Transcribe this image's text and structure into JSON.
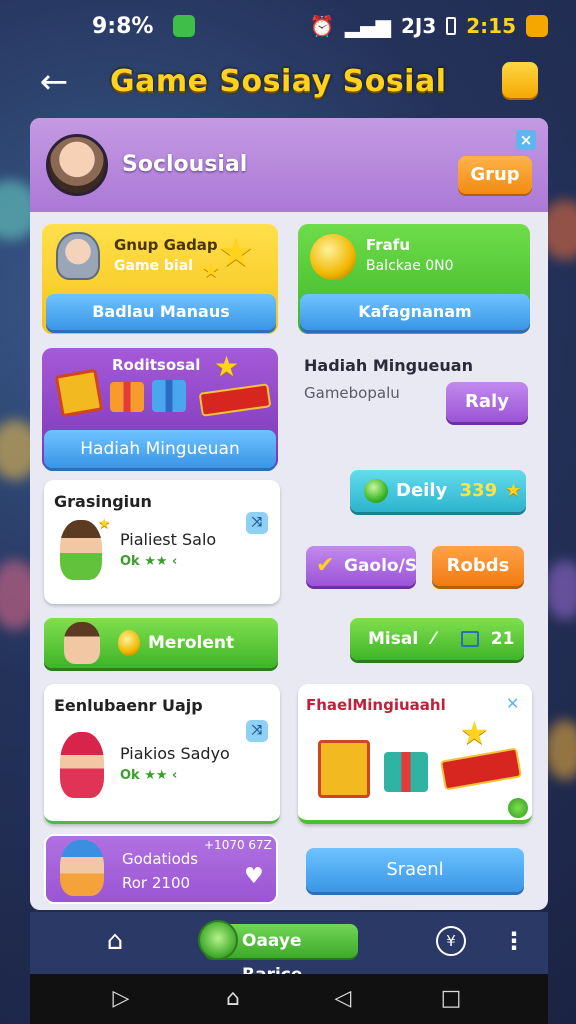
{
  "status_bar": {
    "battery_percent": "9:8%",
    "carrier": "2J3",
    "time": "2:15"
  },
  "header": {
    "title": "Game Sosiay  Sosial"
  },
  "profile": {
    "name": "Soclousial",
    "grup_label": "Grup",
    "close_symbol": "×"
  },
  "cards": {
    "daily_reward": {
      "title": "Gnup Gadap",
      "subtitle": "Game bial",
      "button": "Badlau Manaus"
    },
    "coin_card": {
      "title": "Frafu",
      "subtitle": "Balckae 0N0",
      "button": "Kafagnanam"
    },
    "weekly_reward": {
      "title": "Roditsosal",
      "button": "Hadiah Mingueuan"
    },
    "weekly_info": {
      "title": "Hadiah Mingueuan",
      "subtitle": "Gamebopalu",
      "button": "Raly"
    },
    "player_one": {
      "section": "Grasingiun",
      "name": "Pialiest Salo",
      "rating": "Ok ★★ ‹"
    },
    "daily_points": {
      "label": "Deily",
      "value": "339"
    },
    "action_buttons": {
      "check": "Gaolo/S",
      "rounds": "Robds"
    },
    "merolent_button": "Merolent",
    "mission_button": {
      "label": "Misal",
      "count": "21"
    },
    "player_two": {
      "section": "Eenlubaenr Uajp",
      "name": "Piakios Sadyo",
      "rating": "Ok ★★ ‹"
    },
    "weekly_gifts": {
      "title": "FhaelMingiuaahl"
    },
    "bottom_left": {
      "name": "Godatiods",
      "detail": "Ror 2100",
      "badge": "+1070 67Z"
    },
    "search_button": "Sraenl"
  },
  "bottom_nav": {
    "center_label": "Oaaye Rarice"
  },
  "colors": {
    "panel": "#e9e9f3",
    "header_purple": "#b589dd",
    "yellow_accent": "#ffd21e",
    "green": "#4cbf30",
    "blue": "#48a4ef"
  }
}
